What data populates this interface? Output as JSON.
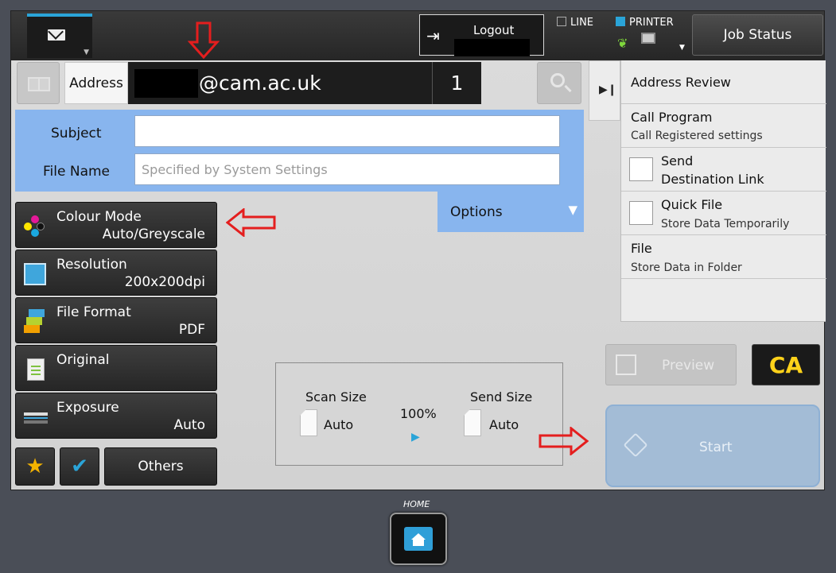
{
  "top_bar": {
    "logout_label": "Logout",
    "line_label": "LINE",
    "printer_label": "PRINTER",
    "job_status_label": "Job Status"
  },
  "address": {
    "label": "Address",
    "value_suffix": "@cam.ac.uk",
    "count": "1"
  },
  "form": {
    "subject_label": "Subject",
    "subject_value": "",
    "file_name_label": "File Name",
    "file_name_placeholder": "Specified by System Settings",
    "options_label": "Options"
  },
  "settings": [
    {
      "title": "Colour Mode",
      "value": "Auto/Greyscale"
    },
    {
      "title": "Resolution",
      "value": "200x200dpi"
    },
    {
      "title": "File Format",
      "value": "PDF"
    },
    {
      "title": "Original",
      "value": ""
    },
    {
      "title": "Exposure",
      "value": "Auto"
    }
  ],
  "others_label": "Others",
  "scan": {
    "scan_size_label": "Scan Size",
    "scan_size_value": "Auto",
    "ratio": "100%",
    "send_size_label": "Send Size",
    "send_size_value": "Auto"
  },
  "right_panel": {
    "address_review": "Address Review",
    "call_program": "Call Program",
    "call_program_sub": "Call Registered settings",
    "send_line1": "Send",
    "send_line2": "Destination Link",
    "quick_file": "Quick File",
    "quick_file_sub": "Store Data Temporarily",
    "file": "File",
    "file_sub": "Store Data in Folder"
  },
  "preview_label": "Preview",
  "ca_label": "CA",
  "start_label": "Start",
  "home_label": "HOME",
  "colors": {
    "accent_blue": "#2aa4d8",
    "panel_blue": "#88b5ee",
    "ca_yellow": "#ffd21a",
    "annotation_red": "#e41e1e"
  }
}
